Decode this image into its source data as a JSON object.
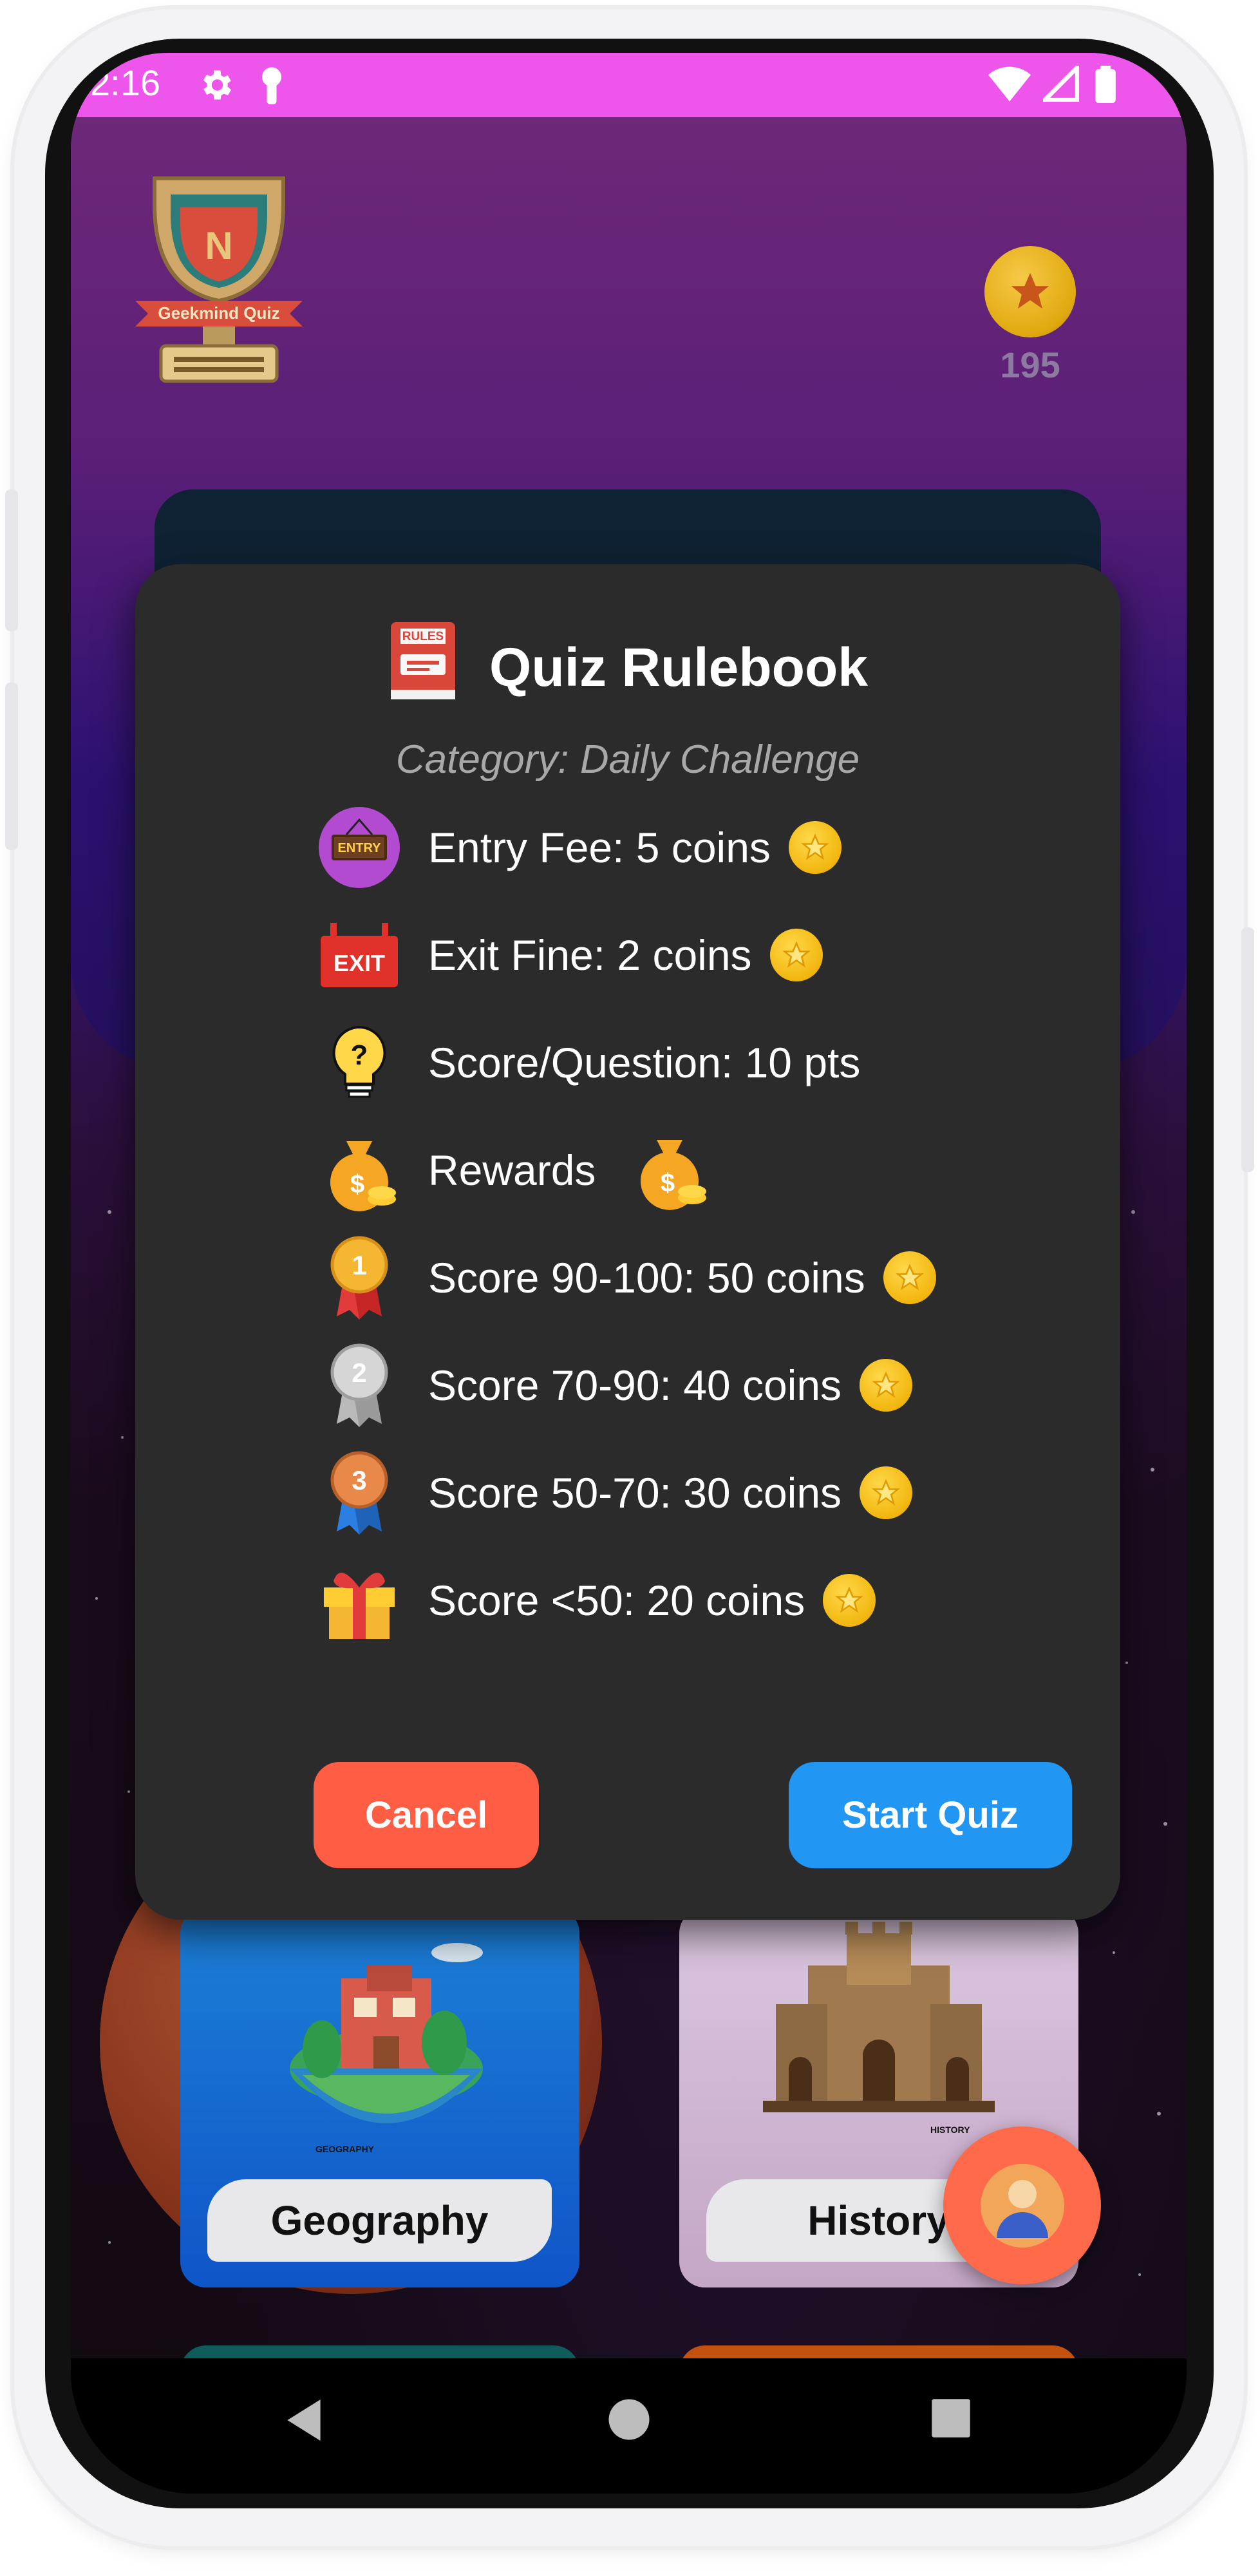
{
  "status_bar": {
    "time": "2:16",
    "icons": [
      "gear-icon",
      "lock-icon",
      "wifi-icon",
      "signal-icon",
      "battery-icon"
    ]
  },
  "header": {
    "logo_text": "Geekmind Quiz",
    "coins": "195"
  },
  "dialog": {
    "title": "Quiz Rulebook",
    "title_icon": "rules-book-icon",
    "subtitle": "Category: Daily Challenge",
    "rules": [
      {
        "icon": "entry-icon",
        "text": "Entry Fee: 5 coins",
        "coin": true
      },
      {
        "icon": "exit-icon",
        "text": "Exit Fine: 2 coins",
        "coin": true
      },
      {
        "icon": "lightbulb-icon",
        "text": "Score/Question: 10 pts",
        "coin": false
      },
      {
        "icon": "money-bag-icon",
        "text": "Rewards",
        "coin": false
      },
      {
        "icon": "gold-medal-icon",
        "text": "Score 90-100: 50 coins",
        "coin": true
      },
      {
        "icon": "silver-medal-icon",
        "text": "Score 70-90: 40 coins",
        "coin": true
      },
      {
        "icon": "bronze-medal-icon",
        "text": "Score 50-70: 30 coins",
        "coin": true
      },
      {
        "icon": "gift-icon",
        "text": "Score <50: 20 coins",
        "coin": true
      }
    ],
    "cancel_label": "Cancel",
    "start_label": "Start Quiz"
  },
  "categories": [
    {
      "label": "Geography",
      "image_caption": "GEOGRAPHY"
    },
    {
      "label": "History",
      "image_caption": "HISTORY"
    }
  ],
  "colors": {
    "status_bar": "#ee55ea",
    "dialog_bg": "#2b2b2b",
    "cancel": "#ff5e45",
    "start": "#2196f3",
    "coin": "#f2b70f"
  }
}
